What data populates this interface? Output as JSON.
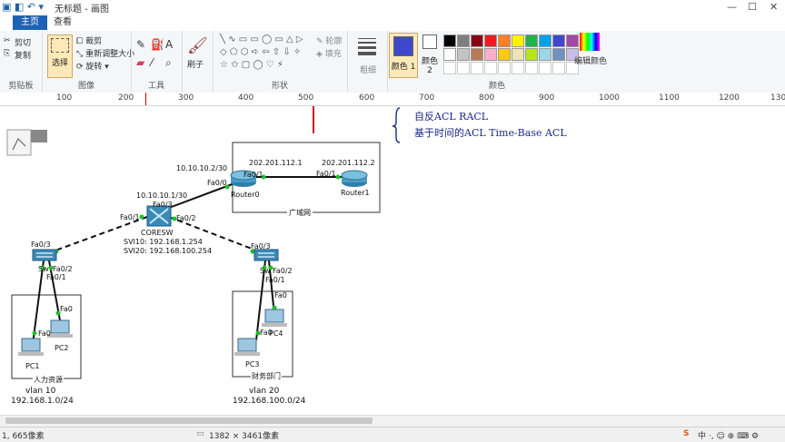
{
  "window": {
    "title": "无标题 - 画图"
  },
  "tabs": {
    "home": "主页",
    "view": "查看"
  },
  "ribbon": {
    "clipboard": {
      "cut": "剪切",
      "copy": "复制",
      "label": "剪贴板"
    },
    "image": {
      "select": "选择",
      "crop": "裁剪",
      "resize": "重新调整大小",
      "rotate": "旋转",
      "label": "图像"
    },
    "tools": {
      "label": "工具"
    },
    "brush": {
      "label": "刷子"
    },
    "shapes": {
      "outline": "轮廓",
      "fill": "填充",
      "label": "形状"
    },
    "size": {
      "label": "粗细"
    },
    "colors": {
      "color1": "颜色 1",
      "color2": "颜色 2",
      "edit": "编辑颜色",
      "label": "颜色",
      "palette": [
        "#000000",
        "#7f7f7f",
        "#880015",
        "#ed1c24",
        "#ff7f27",
        "#fff200",
        "#22b14c",
        "#00a2e8",
        "#3f48cc",
        "#a349a4",
        "#ffffff",
        "#c3c3c3",
        "#b97a57",
        "#ffaec9",
        "#ffc90e",
        "#efe4b0",
        "#b5e61d",
        "#99d9ea",
        "#7092be",
        "#c8bfe7"
      ],
      "color1_value": "#3f48cc",
      "color2_value": "#ffffff"
    }
  },
  "ruler": {
    "ticks": [
      "100",
      "200",
      "300",
      "400",
      "500",
      "600",
      "700",
      "800",
      "900",
      "1000",
      "1100",
      "1200",
      "1300"
    ]
  },
  "notes": {
    "line1": "自反ACL  RACL",
    "line2": "基于时间的ACL  Time-Base ACL"
  },
  "topology": {
    "router0": {
      "name": "Router0",
      "ip_left": "10.10.10.2/30",
      "port_left": "Fa0/0",
      "ip_right": "202.201.112.1",
      "port_right": "Fa0/1"
    },
    "router1": {
      "name": "Router1",
      "ip": "202.201.112.2",
      "port": "Fa0/1"
    },
    "wan_label": "广域网",
    "coresw": {
      "name": "CORESW",
      "ip": "10.10.10.1/30",
      "port_up": "Fa0/3",
      "port_left": "Fa0/1",
      "port_right": "Fa0/2",
      "svi10": "SVI10:  192.168.1.254",
      "svi20": "SVI20:  192.168.100.254"
    },
    "sw_left": {
      "name": "Sw",
      "port_up": "Fa0/3",
      "port_a": "Fa0/2",
      "port_b": "Fa0/1"
    },
    "sw_right": {
      "name": "Sw",
      "port_up": "Fa0/3",
      "port_a": "Fa0/2",
      "port_b": "Fa0/1"
    },
    "pc1": {
      "name": "PC1",
      "port": "Fa0"
    },
    "pc2": {
      "name": "PC2",
      "port": "Fa0"
    },
    "pc3": {
      "name": "PC3",
      "port": "Fa0"
    },
    "pc4": {
      "name": "PC4",
      "port": "Fa0"
    },
    "hr_label": "人力资源",
    "fin_label": "财务部门",
    "vlan10": {
      "name": "vlan 10",
      "net": "192.168.1.0/24"
    },
    "vlan20": {
      "name": "vlan 20",
      "net": "192.168.100.0/24"
    }
  },
  "status": {
    "pos": "1, 665像素",
    "size": "1382 × 3461像素"
  }
}
